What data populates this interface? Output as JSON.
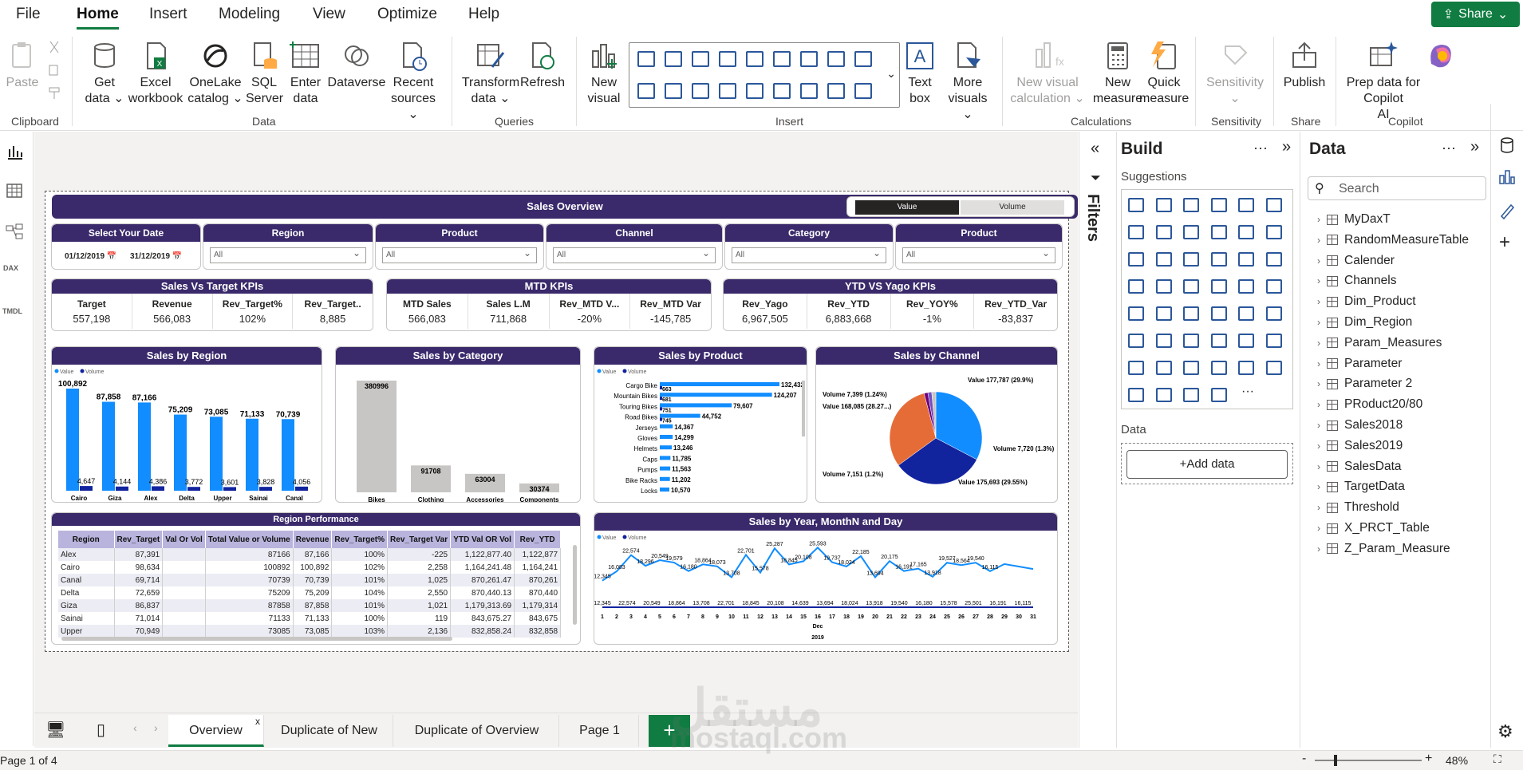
{
  "menu": {
    "items": [
      "File",
      "Home",
      "Insert",
      "Modeling",
      "View",
      "Optimize",
      "Help"
    ],
    "share": "Share"
  },
  "ribbon": {
    "paste": "Paste",
    "get_data": [
      "Get",
      "data ⌄"
    ],
    "excel": [
      "Excel",
      "workbook"
    ],
    "onelake": [
      "OneLake",
      "catalog ⌄"
    ],
    "sql": [
      "SQL",
      "Server"
    ],
    "enter": [
      "Enter",
      "data"
    ],
    "dataverse": "Dataverse",
    "recent": [
      "Recent",
      "sources ⌄"
    ],
    "transform": [
      "Transform",
      "data ⌄"
    ],
    "refresh": "Refresh",
    "new_visual": [
      "New",
      "visual"
    ],
    "textbox": [
      "Text",
      "box"
    ],
    "more_visuals": [
      "More",
      "visuals ⌄"
    ],
    "new_visual_calc": [
      "New visual",
      "calculation ⌄"
    ],
    "new_measure": [
      "New",
      "measure"
    ],
    "quick_measure": [
      "Quick",
      "measure"
    ],
    "sensitivity": [
      "Sensitivity",
      "⌄"
    ],
    "publish": "Publish",
    "prep_copilot": [
      "Prep data for Copilot",
      "AI"
    ],
    "groups": {
      "clipboard": "Clipboard",
      "data": "Data",
      "queries": "Queries",
      "insert": "Insert",
      "calculations": "Calculations",
      "sensitivity": "Sensitivity",
      "share": "Share",
      "copilot": "Copilot"
    }
  },
  "report": {
    "title": "Sales Overview",
    "toggle": {
      "value": "Value",
      "volume": "Volume"
    },
    "slicers": [
      {
        "title": "Select Your Date",
        "from": "01/12/2019 📅",
        "to": "31/12/2019 📅"
      },
      {
        "title": "Region",
        "value": "All"
      },
      {
        "title": "Product",
        "value": "All"
      },
      {
        "title": "Channel",
        "value": "All"
      },
      {
        "title": "Category",
        "value": "All"
      },
      {
        "title": "Product",
        "value": "All"
      }
    ],
    "kpis": [
      {
        "title": "Sales Vs Target KPIs",
        "cells": [
          {
            "l": "Target",
            "v": "557,198"
          },
          {
            "l": "Revenue",
            "v": "566,083"
          },
          {
            "l": "Rev_Target%",
            "v": "102%"
          },
          {
            "l": "Rev_Target..",
            "v": "8,885"
          }
        ]
      },
      {
        "title": "MTD KPIs",
        "cells": [
          {
            "l": "MTD Sales",
            "v": "566,083"
          },
          {
            "l": "Sales L.M",
            "v": "711,868"
          },
          {
            "l": "Rev_MTD V...",
            "v": "-20%"
          },
          {
            "l": "Rev_MTD Var",
            "v": "-145,785"
          }
        ]
      },
      {
        "title": "YTD VS Yago KPIs",
        "cells": [
          {
            "l": "Rev_Yago",
            "v": "6,967,505"
          },
          {
            "l": "Rev_YTD",
            "v": "6,883,668"
          },
          {
            "l": "Rev_YOY%",
            "v": "-1%"
          },
          {
            "l": "Rev_YTD_Var",
            "v": "-83,837"
          }
        ]
      }
    ],
    "legend": {
      "value": "Value",
      "volume": "Volume"
    },
    "year_label": "2019",
    "month_label": "Dec",
    "table": {
      "title": "Region Performance",
      "headers": [
        "Region",
        "Rev_Target",
        "Val Or Vol",
        "Total Value or Volume",
        "Revenue",
        "Rev_Target%",
        "Rev_Target Var",
        "YTD Val OR Vol",
        "Rev_YTD"
      ],
      "rows": [
        [
          "Alex",
          "87,391",
          "",
          "87166",
          "87,166",
          "100%",
          "-225",
          "1,122,877.40",
          "1,122,877"
        ],
        [
          "Cairo",
          "98,634",
          "",
          "100892",
          "100,892",
          "102%",
          "2,258",
          "1,164,241.48",
          "1,164,241"
        ],
        [
          "Canal",
          "69,714",
          "",
          "70739",
          "70,739",
          "101%",
          "1,025",
          "870,261.47",
          "870,261"
        ],
        [
          "Delta",
          "72,659",
          "",
          "75209",
          "75,209",
          "104%",
          "2,550",
          "870,440.13",
          "870,440"
        ],
        [
          "Giza",
          "86,837",
          "",
          "87858",
          "87,858",
          "101%",
          "1,021",
          "1,179,313.69",
          "1,179,314"
        ],
        [
          "Sainai",
          "71,014",
          "",
          "71133",
          "71,133",
          "100%",
          "119",
          "843,675.27",
          "843,675"
        ],
        [
          "Upper",
          "70,949",
          "",
          "73085",
          "73,085",
          "103%",
          "2,136",
          "832,858.24",
          "832,858"
        ]
      ]
    }
  },
  "chart_data": [
    {
      "type": "bar",
      "title": "Sales by Region",
      "categories": [
        "Cairo",
        "Giza",
        "Alex",
        "Delta",
        "Upper",
        "Sainai",
        "Canal"
      ],
      "series": [
        {
          "name": "Value",
          "values": [
            100892,
            87858,
            87166,
            75209,
            73085,
            71133,
            70739
          ]
        },
        {
          "name": "Volume",
          "values": [
            4647,
            4144,
            4386,
            3772,
            3601,
            3828,
            4056
          ]
        }
      ],
      "labels_value": [
        "100,892",
        "87,858",
        "87,166",
        "75,209",
        "73,085",
        "71,133",
        "70,739"
      ],
      "labels_volume": [
        "4,647",
        "4,144",
        "4,386",
        "3,772",
        "3,601",
        "3,828",
        "4,056"
      ]
    },
    {
      "type": "bar",
      "title": "Sales by Category",
      "categories": [
        "Bikes",
        "Clothing",
        "Accessories",
        "Components"
      ],
      "values": [
        380996,
        91708,
        63004,
        30374
      ],
      "labels": [
        "380996",
        "91708",
        "63004",
        "30374"
      ]
    },
    {
      "type": "bar",
      "title": "Sales by Product",
      "orientation": "horizontal",
      "categories": [
        "Cargo Bike",
        "Mountain Bikes",
        "Touring Bikes",
        "Road Bikes",
        "Jerseys",
        "Gloves",
        "Helmets",
        "Caps",
        "Pumps",
        "Bike Racks",
        "Locks"
      ],
      "series": [
        {
          "name": "Value",
          "values": [
            132432,
            124207,
            79607,
            44752,
            14367,
            14299,
            13246,
            11785,
            11563,
            11202,
            10570
          ]
        },
        {
          "name": "Volume",
          "values": [
            663,
            681,
            751,
            745,
            null,
            null,
            null,
            null,
            null,
            null,
            null
          ]
        }
      ],
      "labels_value": [
        "132,432",
        "124,207",
        "79,607",
        "44,752",
        "14,367",
        "14,299",
        "13,246",
        "11,785",
        "11,563",
        "11,202",
        "10,570"
      ],
      "labels_volume": [
        "663",
        "681",
        "751",
        "745"
      ]
    },
    {
      "type": "pie",
      "title": "Sales by Channel",
      "slices": [
        {
          "label": "Value 177,787 (29.9%)",
          "value": 177787
        },
        {
          "label": "Value 175,693 (29.55%)",
          "value": 175693
        },
        {
          "label": "Value 168,085 (28.27...)",
          "value": 168085
        },
        {
          "label": "Volume 7,720 (1.3%)",
          "value": 7720
        },
        {
          "label": "Volume 7,399 (1.24%)",
          "value": 7399
        },
        {
          "label": "Volume 7,151 (1.2%)",
          "value": 7151
        }
      ]
    },
    {
      "type": "line",
      "title": "Sales by Year, MonthN and Day",
      "x": [
        1,
        2,
        3,
        4,
        5,
        6,
        7,
        8,
        9,
        10,
        11,
        12,
        13,
        14,
        15,
        16,
        17,
        18,
        19,
        20,
        21,
        22,
        23,
        24,
        25,
        26,
        27,
        28,
        29,
        30,
        31
      ],
      "x_tick_labels": [
        "1",
        "2",
        "3",
        "4",
        "5",
        "6",
        "7",
        "8",
        "9",
        "10",
        "11",
        "12",
        "13",
        "14",
        "15",
        "16",
        "17",
        "18",
        "19",
        "20",
        "21",
        "22",
        "23",
        "24",
        "25",
        "26",
        "27",
        "28",
        "29",
        "30",
        "31"
      ],
      "series": [
        {
          "name": "Value",
          "values": [
            12345,
            16083,
            22574,
            18296,
            20549,
            19579,
            16180,
            18864,
            18073,
            13708,
            22701,
            15578,
            25287,
            18845,
            20108,
            25593,
            19737,
            18024,
            22185,
            13694,
            20175,
            16191,
            17165,
            13918,
            19527,
            18564,
            19540,
            16115,
            19000,
            18000,
            17000
          ],
          "labels": [
            "12,345",
            "16,083",
            "22,574",
            "18,296",
            "20,549",
            "19,579",
            "16,180",
            "18,864",
            "18,073",
            "13,708",
            "22,701",
            "15,578",
            "25,287",
            "18,845",
            "20,108",
            "25,593",
            "19,737",
            "18,024",
            "22,185",
            "13,694",
            "20,175",
            "16,191",
            "17,165",
            "13,918",
            "19,527",
            "18,564",
            "19,540",
            "16,115"
          ]
        },
        {
          "name": "Volume",
          "values": [
            600,
            620,
            580,
            610,
            640,
            600,
            590,
            620,
            610,
            600,
            630,
            600,
            610,
            600,
            620,
            600,
            610,
            600,
            620,
            600,
            610,
            600,
            610,
            600,
            620,
            600,
            610,
            600,
            610,
            600,
            610
          ]
        }
      ],
      "volume_labels": [
        "12,345",
        "22,574",
        "20,549",
        "18,864",
        "13,708",
        "22,701",
        "18,845",
        "20,108",
        "14,639",
        "13,694",
        "18,024",
        "13,918",
        "19,540",
        "16,180",
        "15,578",
        "25,501",
        "16,191",
        "16,115"
      ]
    }
  ],
  "panes": {
    "filters": "Filters",
    "build": {
      "title": "Build",
      "suggestions": "Suggestions",
      "data": "Data",
      "add": "+Add data"
    },
    "data": {
      "title": "Data",
      "search": "Search",
      "tables": [
        "MyDaxT",
        "RandomMeasureTable",
        "Calender",
        "Channels",
        "Dim_Product",
        "Dim_Region",
        "Param_Measures",
        "Parameter",
        "Parameter 2",
        "PRoduct20/80",
        "Sales2018",
        "Sales2019",
        "SalesData",
        "TargetData",
        "Threshold",
        "X_PRCT_Table",
        "Z_Param_Measure"
      ]
    }
  },
  "tabs": [
    "Overview",
    "Duplicate of New",
    "Duplicate of Overview",
    "Page 1"
  ],
  "status": {
    "page": "Page 1 of 4",
    "zoom": "48%"
  },
  "watermark": {
    "arabic": "مستقل",
    "latin": "mostaql.com"
  },
  "colors": {
    "accent": "#107c41",
    "report_bar": "#3a2a6b",
    "value": "#118dff",
    "volume": "#12239e",
    "pie_orange": "#e66c37",
    "pie_purple": "#6b007b"
  }
}
